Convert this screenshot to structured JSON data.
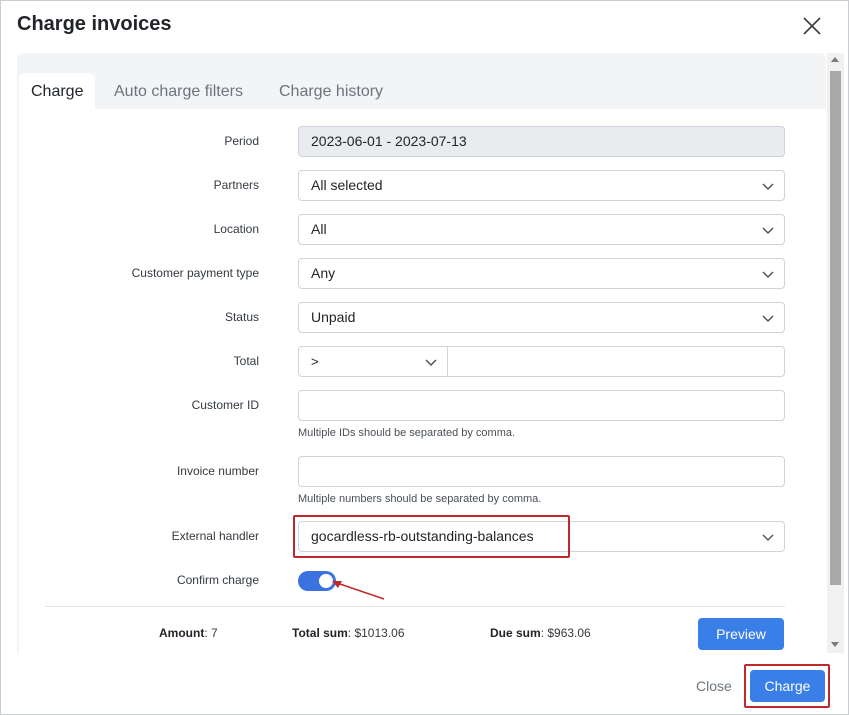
{
  "dialog": {
    "title": "Charge invoices",
    "close_icon": "close-icon"
  },
  "tabs": [
    {
      "label": "Charge",
      "active": true
    },
    {
      "label": "Auto charge filters",
      "active": false
    },
    {
      "label": "Charge history",
      "active": false
    }
  ],
  "form": {
    "period": {
      "label": "Period",
      "value": "2023-06-01 - 2023-07-13"
    },
    "partners": {
      "label": "Partners",
      "value": "All selected"
    },
    "location": {
      "label": "Location",
      "value": "All"
    },
    "payment_type": {
      "label": "Customer payment type",
      "value": "Any"
    },
    "status": {
      "label": "Status",
      "value": "Unpaid"
    },
    "total": {
      "label": "Total",
      "operator": ">",
      "value": ""
    },
    "customer_id": {
      "label": "Customer ID",
      "value": "",
      "hint": "Multiple IDs should be separated by comma."
    },
    "invoice_number": {
      "label": "Invoice number",
      "value": "",
      "hint": "Multiple numbers should be separated by comma."
    },
    "external_handler": {
      "label": "External handler",
      "value": "gocardless-rb-outstanding-balances"
    },
    "confirm_charge": {
      "label": "Confirm charge",
      "checked": true
    }
  },
  "summary": {
    "amount_label": "Amount",
    "amount_value": ": 7",
    "total_sum_label": "Total sum",
    "total_sum_value": ": $1013.06",
    "due_sum_label": "Due sum",
    "due_sum_value": ": $963.06"
  },
  "buttons": {
    "preview": "Preview",
    "close": "Close",
    "charge": "Charge"
  },
  "colors": {
    "primary": "#3a7ee8",
    "highlight": "#c0282d"
  }
}
